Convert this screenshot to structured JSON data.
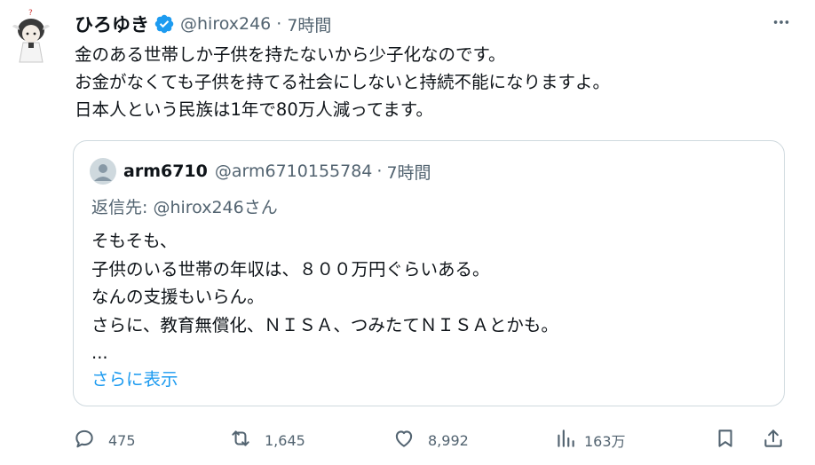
{
  "tweet": {
    "display_name": "ひろゆき",
    "handle": "@hirox246",
    "separator": "·",
    "time": "7時間",
    "lines": [
      "金のある世帯しか子供を持たないから少子化なのです。",
      "お金がなくても子供を持てる社会にしないと持続不能になりますよ。",
      "日本人という民族は1年で80万人減ってます。"
    ]
  },
  "quote": {
    "display_name": "arm6710",
    "handle": "@arm6710155784",
    "separator": "·",
    "time": "7時間",
    "reply_to": "返信先: @hirox246さん",
    "lines": [
      "そもそも、",
      "子供のいる世帯の年収は、８００万円ぐらいある。",
      "なんの支援もいらん。",
      "さらに、教育無償化、ＮＩＳＡ、つみたてＮＩＳＡとかも。",
      "..."
    ],
    "show_more": "さらに表示"
  },
  "actions": {
    "replies": "475",
    "reposts": "1,645",
    "likes": "8,992",
    "views": "163万"
  },
  "colors": {
    "text": "#0f1419",
    "secondary": "#536471",
    "link": "#1d9bf0",
    "verified": "#1d9bf0",
    "border": "#cfd9de"
  },
  "icons": {
    "verified": "verified-badge-icon",
    "more": "more-icon",
    "reply": "reply-icon",
    "repost": "repost-icon",
    "like": "like-icon",
    "views": "views-icon",
    "bookmark": "bookmark-icon",
    "share": "share-icon"
  }
}
